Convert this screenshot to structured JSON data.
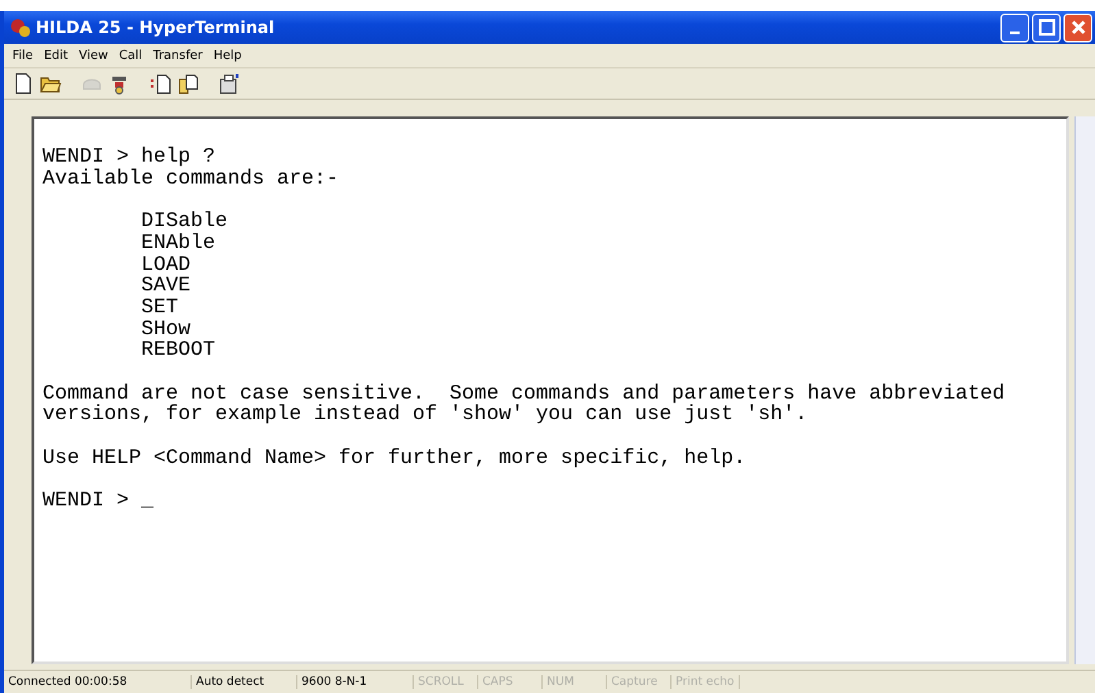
{
  "window": {
    "title": "HILDA 25 - HyperTerminal"
  },
  "menu": [
    "File",
    "Edit",
    "View",
    "Call",
    "Transfer",
    "Help"
  ],
  "toolbar": [
    {
      "kind": "new",
      "disabled": false
    },
    {
      "kind": "open",
      "disabled": false
    },
    {
      "kind": "call",
      "disabled": true
    },
    {
      "kind": "hangup",
      "disabled": false
    },
    {
      "kind": "send",
      "disabled": false
    },
    {
      "kind": "receive",
      "disabled": false
    },
    {
      "kind": "properties",
      "disabled": false
    }
  ],
  "terminal": {
    "blocks": [
      {
        "indented": false,
        "lines": [
          "WENDI > help ?",
          "Available commands are:-"
        ]
      },
      {
        "indented": true,
        "lines": [
          "DISable",
          "ENAble",
          "LOAD",
          "SAVE",
          "SET",
          "SHow",
          "REBOOT"
        ]
      },
      {
        "indented": false,
        "lines": [
          "Command are not case sensitive.  Some commands and parameters have abbreviated",
          "versions, for example instead of 'show' you can use just 'sh'."
        ]
      },
      {
        "indented": false,
        "lines": [
          "Use HELP <Command Name> for further, more specific, help."
        ]
      },
      {
        "indented": false,
        "lines": [
          "WENDI > _"
        ]
      }
    ]
  },
  "status_bar": [
    {
      "text": "Connected 00:00:58",
      "disabled": false
    },
    {
      "text": "Auto detect",
      "disabled": false
    },
    {
      "text": "9600 8-N-1",
      "disabled": false
    },
    {
      "text": "SCROLL",
      "disabled": true
    },
    {
      "text": "CAPS",
      "disabled": true
    },
    {
      "text": "NUM",
      "disabled": true
    },
    {
      "text": "Capture",
      "disabled": true
    },
    {
      "text": "Print echo",
      "disabled": true
    }
  ]
}
